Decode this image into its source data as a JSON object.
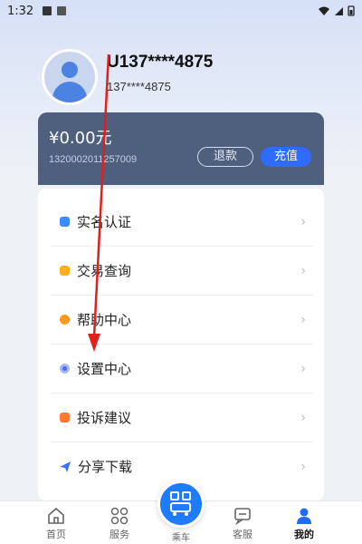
{
  "status_bar": {
    "time": "1:32"
  },
  "profile": {
    "username": "U137****4875",
    "phone": "137****4875"
  },
  "wallet": {
    "balance": "¥0.00元",
    "card_number": "1320002011257009",
    "refund_label": "退款",
    "recharge_label": "充值"
  },
  "menu": {
    "items": [
      {
        "label": "实名认证",
        "icon": "id-card-icon",
        "color": "#3a8bff"
      },
      {
        "label": "交易查询",
        "icon": "wallet-icon",
        "color": "#ffb020"
      },
      {
        "label": "帮助中心",
        "icon": "chat-icon",
        "color": "#ff9a1f"
      },
      {
        "label": "设置中心",
        "icon": "gear-icon",
        "color": "#4a6cf0"
      },
      {
        "label": "投诉建议",
        "icon": "note-icon",
        "color": "#ff7a2e"
      },
      {
        "label": "分享下载",
        "icon": "send-icon",
        "color": "#3a6eff"
      }
    ],
    "arrow": "›"
  },
  "nav": {
    "items": [
      {
        "label": "首页",
        "icon": "home-icon"
      },
      {
        "label": "服务",
        "icon": "grid-icon"
      },
      {
        "label": "乘车",
        "icon": "qr-bus-icon"
      },
      {
        "label": "客服",
        "icon": "chat-bubble-icon"
      },
      {
        "label": "我的",
        "icon": "person-icon"
      }
    ],
    "active": "我的"
  },
  "colors": {
    "accent": "#2f6bff",
    "wallet_bg": "#4f5f7e",
    "annotation_arrow": "#e0201c"
  }
}
